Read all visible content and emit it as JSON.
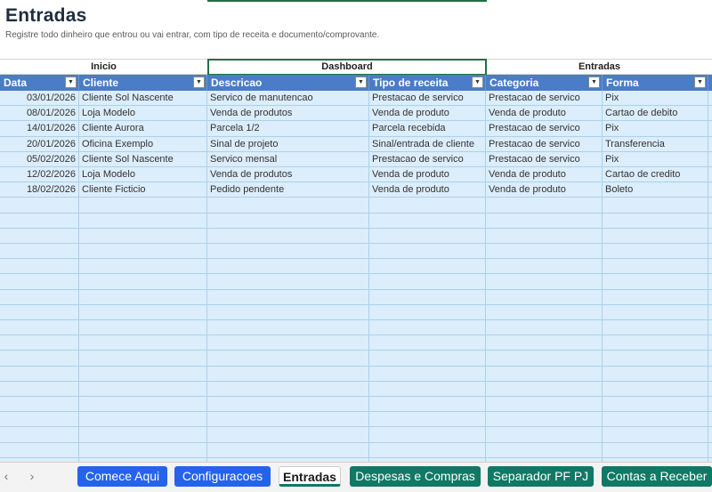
{
  "sheet": {
    "title": "Entradas",
    "subtitle": "Registre todo dinheiro que entrou ou vai entrar, com tipo de receita e documento/comprovante."
  },
  "nav": [
    {
      "label": "Inicio"
    },
    {
      "label": "Dashboard"
    },
    {
      "label": "Entradas"
    }
  ],
  "table": {
    "columns": [
      "Data",
      "Cliente",
      "Descricao",
      "Tipo de receita",
      "Categoria",
      "Forma"
    ],
    "rows": [
      [
        "03/01/2026",
        "Cliente Sol Nascente",
        "Servico de manutencao",
        "Prestacao de servico",
        "Prestacao de servico",
        "Pix"
      ],
      [
        "08/01/2026",
        "Loja Modelo",
        "Venda de produtos",
        "Venda de produto",
        "Venda de produto",
        "Cartao de debito"
      ],
      [
        "14/01/2026",
        "Cliente Aurora",
        "Parcela 1/2",
        "Parcela recebida",
        "Prestacao de servico",
        "Pix"
      ],
      [
        "20/01/2026",
        "Oficina Exemplo",
        "Sinal de projeto",
        "Sinal/entrada de cliente",
        "Prestacao de servico",
        "Transferencia"
      ],
      [
        "05/02/2026",
        "Cliente Sol Nascente",
        "Servico mensal",
        "Prestacao de servico",
        "Prestacao de servico",
        "Pix"
      ],
      [
        "12/02/2026",
        "Loja Modelo",
        "Venda de produtos",
        "Venda de produto",
        "Venda de produto",
        "Cartao de credito"
      ],
      [
        "18/02/2026",
        "Cliente Ficticio",
        "Pedido pendente",
        "Venda de produto",
        "Venda de produto",
        "Boleto"
      ]
    ],
    "empty_rows": 17
  },
  "tabs": [
    {
      "label": "Comece Aqui",
      "style": "blue"
    },
    {
      "label": "Configuracoes",
      "style": "blue"
    },
    {
      "label": "Entradas",
      "style": "active"
    },
    {
      "label": "Despesas e Compras",
      "style": "green"
    },
    {
      "label": "Separador PF PJ",
      "style": "green"
    },
    {
      "label": "Contas a Receber",
      "style": "green"
    }
  ],
  "icons": {
    "prev": "chevron-left-icon",
    "next": "chevron-right-icon",
    "filter": "filter-dropdown-icon"
  },
  "colors": {
    "header": "#4a7cc7",
    "grid": "#dcedfb",
    "tab_blue": "#2563eb",
    "tab_green": "#117865",
    "selection": "#1e7145"
  }
}
